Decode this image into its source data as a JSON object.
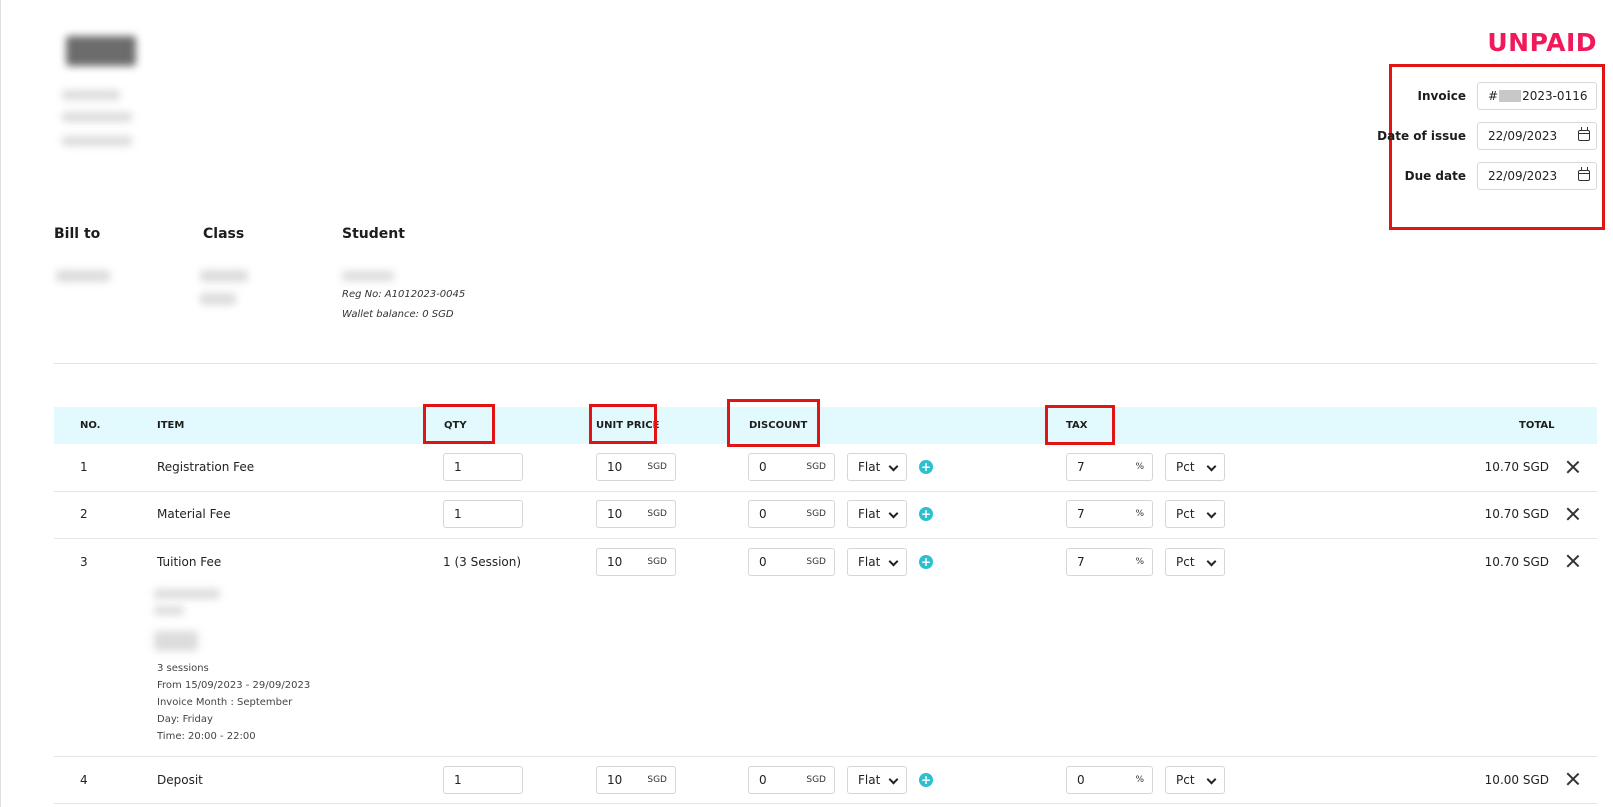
{
  "status": "UNPAID",
  "invoice_meta": {
    "invoice_label": "Invoice",
    "invoice_prefix": "#",
    "invoice_suffix": "2023-0116",
    "issue_label": "Date of issue",
    "issue_value": "22/09/2023",
    "due_label": "Due date",
    "due_value": "22/09/2023"
  },
  "sections": {
    "bill_to": "Bill to",
    "class": "Class",
    "student": "Student",
    "reg_no": "Reg No: A1012023-0045",
    "wallet": "Wallet balance: 0 SGD"
  },
  "table": {
    "headers": {
      "no": "NO.",
      "item": "ITEM",
      "qty": "QTY",
      "unit_price": "UNIT PRICE",
      "discount": "DISCOUNT",
      "tax": "TAX",
      "total": "TOTAL"
    },
    "rows": [
      {
        "no": "1",
        "item": "Registration Fee",
        "qty": "1",
        "price": "10",
        "price_unit": "SGD",
        "discount": "0",
        "discount_unit": "SGD",
        "discount_type": "Flat",
        "tax": "7",
        "tax_unit": "%",
        "tax_type": "Pct",
        "total": "10.70 SGD"
      },
      {
        "no": "2",
        "item": "Material Fee",
        "qty": "1",
        "price": "10",
        "price_unit": "SGD",
        "discount": "0",
        "discount_unit": "SGD",
        "discount_type": "Flat",
        "tax": "7",
        "tax_unit": "%",
        "tax_type": "Pct",
        "total": "10.70 SGD"
      },
      {
        "no": "3",
        "item": "Tuition Fee",
        "qty": "1 (3 Session)",
        "price": "10",
        "price_unit": "SGD",
        "discount": "0",
        "discount_unit": "SGD",
        "discount_type": "Flat",
        "tax": "7",
        "tax_unit": "%",
        "tax_type": "Pct",
        "total": "10.70 SGD",
        "details": [
          "3 sessions",
          "From 15/09/2023 - 29/09/2023",
          "Invoice Month : September",
          "Day: Friday",
          "Time: 20:00 - 22:00"
        ]
      },
      {
        "no": "4",
        "item": "Deposit",
        "qty": "1",
        "price": "10",
        "price_unit": "SGD",
        "discount": "0",
        "discount_unit": "SGD",
        "discount_type": "Flat",
        "tax": "0",
        "tax_unit": "%",
        "tax_type": "Pct",
        "total": "10.00 SGD"
      }
    ]
  },
  "colors": {
    "status": "#f0195a",
    "annotation_box": "#e11414",
    "table_header_bg": "#e2fafd",
    "plus_icon": "#2cc0cf"
  }
}
